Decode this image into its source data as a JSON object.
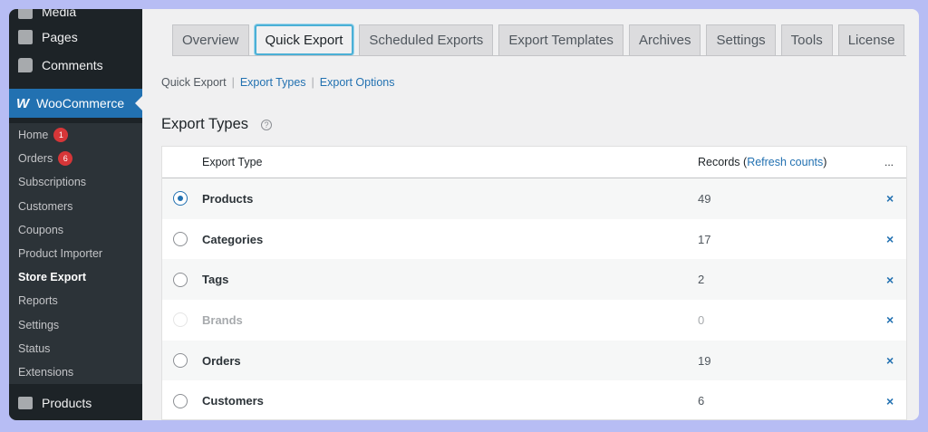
{
  "sidebar": {
    "top_items": [
      {
        "label": "Media",
        "icon": "media-icon"
      },
      {
        "label": "Pages",
        "icon": "pages-icon"
      },
      {
        "label": "Comments",
        "icon": "comments-icon"
      }
    ],
    "woocommerce": {
      "logo": "W",
      "label": "WooCommerce"
    },
    "submenu": [
      {
        "label": "Home",
        "badge": "1"
      },
      {
        "label": "Orders",
        "badge": "6"
      },
      {
        "label": "Subscriptions"
      },
      {
        "label": "Customers"
      },
      {
        "label": "Coupons"
      },
      {
        "label": "Product Importer"
      },
      {
        "label": "Store Export",
        "active": true
      },
      {
        "label": "Reports"
      },
      {
        "label": "Settings"
      },
      {
        "label": "Status"
      },
      {
        "label": "Extensions"
      }
    ],
    "products": {
      "label": "Products",
      "icon": "products-icon"
    }
  },
  "tabs": [
    {
      "label": "Overview"
    },
    {
      "label": "Quick Export",
      "active": true
    },
    {
      "label": "Scheduled Exports"
    },
    {
      "label": "Export Templates"
    },
    {
      "label": "Archives"
    },
    {
      "label": "Settings"
    },
    {
      "label": "Tools"
    },
    {
      "label": "License"
    }
  ],
  "subnav": {
    "current": "Quick Export",
    "link1": "Export Types",
    "link2": "Export Options",
    "separator": "|"
  },
  "section": {
    "title": "Export Types",
    "help_icon": "?"
  },
  "table": {
    "header_type": "Export Type",
    "header_records": "Records (",
    "header_refresh": "Refresh counts",
    "header_records_close": ")",
    "header_dots": "...",
    "rows": [
      {
        "name": "Products",
        "count": "49",
        "state": "checked"
      },
      {
        "name": "Categories",
        "count": "17",
        "state": "unchecked"
      },
      {
        "name": "Tags",
        "count": "2",
        "state": "unchecked"
      },
      {
        "name": "Brands",
        "count": "0",
        "state": "disabled"
      },
      {
        "name": "Orders",
        "count": "19",
        "state": "unchecked"
      },
      {
        "name": "Customers",
        "count": "6",
        "state": "unchecked"
      }
    ],
    "remove_glyph": "×"
  },
  "colors": {
    "accent": "#2271b1",
    "sidebar": "#1d2327",
    "background": "#b7bdf4"
  }
}
